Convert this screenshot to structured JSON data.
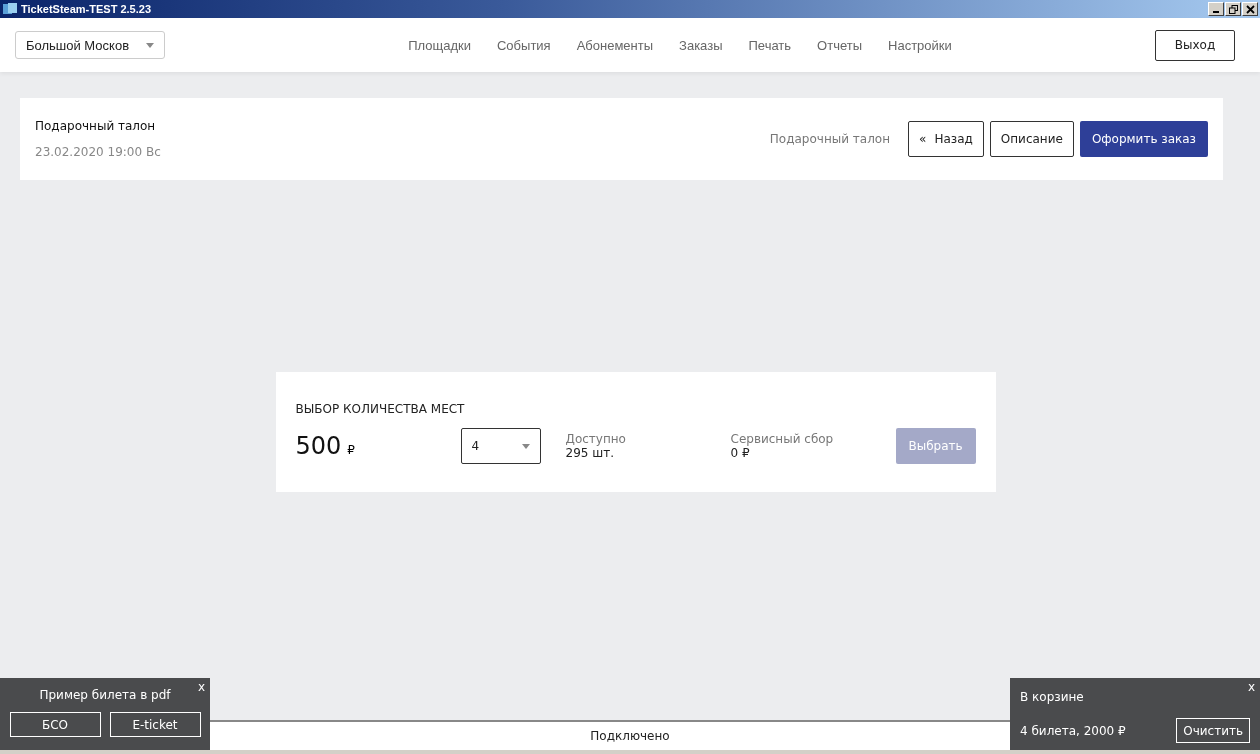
{
  "window": {
    "title": "TicketSteam-TEST 2.5.23"
  },
  "header": {
    "venue_select": "Большой Москов",
    "nav": [
      "Площадки",
      "События",
      "Абонементы",
      "Заказы",
      "Печать",
      "Отчеты",
      "Настройки"
    ],
    "logout": "Выход"
  },
  "event": {
    "title": "Подарочный талон",
    "date": "23.02.2020 19:00  Вс",
    "crumb": "Подарочный талон",
    "back_icon": "«",
    "back": "Назад",
    "description": "Описание",
    "checkout": "Оформить заказ"
  },
  "quantity": {
    "heading": "ВЫБОР КОЛИЧЕСТВА МЕСТ",
    "price": "500",
    "currency": "₽",
    "count": "4",
    "available_label": "Доступно",
    "available": "295 шт.",
    "fee_label": "Сервисный сбор",
    "fee": "0 ₽",
    "select": "Выбрать",
    "select_disabled": true
  },
  "status_bar": "Подключено",
  "pdf_popup": {
    "close": "x",
    "title": "Пример билета в pdf",
    "buttons": [
      "БСО",
      "E-ticket"
    ]
  },
  "cart_popup": {
    "close": "x",
    "title": "В корзине",
    "summary": "4 билета, 2000 ₽",
    "clear": "Очистить"
  }
}
